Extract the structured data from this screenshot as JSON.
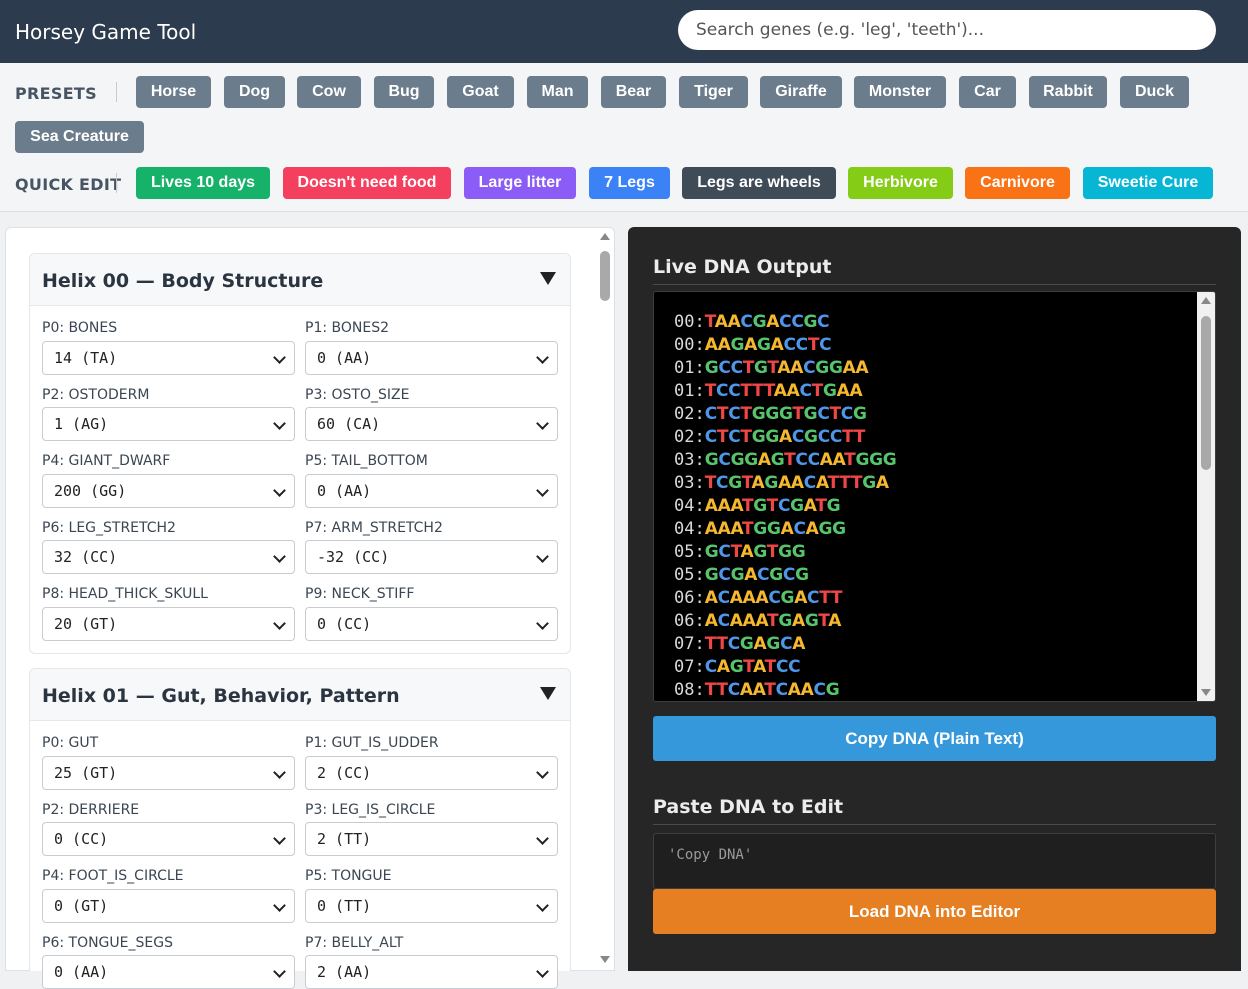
{
  "app": {
    "title": "Horsey Game Tool"
  },
  "search": {
    "placeholder": "Search genes (e.g. 'leg', 'teeth')..."
  },
  "presets": {
    "label": "PRESETS",
    "items": [
      "Horse",
      "Dog",
      "Cow",
      "Bug",
      "Goat",
      "Man",
      "Bear",
      "Tiger",
      "Giraffe",
      "Monster",
      "Car",
      "Rabbit",
      "Duck",
      "Sea Creature"
    ]
  },
  "quick_edit": {
    "label": "QUICK EDIT",
    "items": [
      {
        "label": "Lives 10 days",
        "color": "#17b26a"
      },
      {
        "label": "Doesn't need food",
        "color": "#f43f5e"
      },
      {
        "label": "Large litter",
        "color": "#8b5cf6"
      },
      {
        "label": "7 Legs",
        "color": "#3b82f6"
      },
      {
        "label": "Legs are wheels",
        "color": "#404b58"
      },
      {
        "label": "Herbivore",
        "color": "#84cc16"
      },
      {
        "label": "Carnivore",
        "color": "#f97316"
      },
      {
        "label": "Sweetie Cure",
        "color": "#06b6d4"
      }
    ]
  },
  "helices": [
    {
      "title": "Helix 00 — Body Structure",
      "fields": [
        {
          "label": "P0: BONES",
          "value": "14 (TA)"
        },
        {
          "label": "P1: BONES2",
          "value": "0 (AA)"
        },
        {
          "label": "P2: OSTODERM",
          "value": "1 (AG)"
        },
        {
          "label": "P3: OSTO_SIZE",
          "value": "60 (CA)"
        },
        {
          "label": "P4: GIANT_DWARF",
          "value": "200 (GG)"
        },
        {
          "label": "P5: TAIL_BOTTOM",
          "value": "0 (AA)"
        },
        {
          "label": "P6: LEG_STRETCH2",
          "value": "32 (CC)"
        },
        {
          "label": "P7: ARM_STRETCH2",
          "value": "-32 (CC)"
        },
        {
          "label": "P8: HEAD_THICK_SKULL",
          "value": "20 (GT)"
        },
        {
          "label": "P9: NECK_STIFF",
          "value": "0 (CC)"
        }
      ]
    },
    {
      "title": "Helix 01 — Gut, Behavior, Pattern",
      "fields": [
        {
          "label": "P0: GUT",
          "value": "25 (GT)"
        },
        {
          "label": "P1: GUT_IS_UDDER",
          "value": "2 (CC)"
        },
        {
          "label": "P2: DERRIERE",
          "value": "0 (CC)"
        },
        {
          "label": "P3: LEG_IS_CIRCLE",
          "value": "2 (TT)"
        },
        {
          "label": "P4: FOOT_IS_CIRCLE",
          "value": "0 (GT)"
        },
        {
          "label": "P5: TONGUE",
          "value": "0 (TT)"
        },
        {
          "label": "P6: TONGUE_SEGS",
          "value": "0 (AA)"
        },
        {
          "label": "P7: BELLY_ALT",
          "value": "2 (AA)"
        }
      ]
    }
  ],
  "output": {
    "title": "Live DNA Output",
    "base_colors": {
      "A": "#f5b82e",
      "C": "#4f95e8",
      "G": "#57c46b",
      "T": "#f04646"
    },
    "lines": [
      {
        "num": "00",
        "seq": "TAACGACCGC"
      },
      {
        "num": "00",
        "seq": "AAGAGACCTC"
      },
      {
        "num": "01",
        "seq": "GCCTGTAACGGAA"
      },
      {
        "num": "01",
        "seq": "TCCTTTAACTGAA"
      },
      {
        "num": "02",
        "seq": "CTCTGGGTGCTCG"
      },
      {
        "num": "02",
        "seq": "CTCTGGACGCCTT"
      },
      {
        "num": "03",
        "seq": "GCGGAGTCCAATGGG"
      },
      {
        "num": "03",
        "seq": "TCGTAGAACATTTGA"
      },
      {
        "num": "04",
        "seq": "AAATGTCGATG"
      },
      {
        "num": "04",
        "seq": "AAATGGACAGG"
      },
      {
        "num": "05",
        "seq": "GCTAGTGG"
      },
      {
        "num": "05",
        "seq": "GCGACGCG"
      },
      {
        "num": "06",
        "seq": "ACAAACGACTT"
      },
      {
        "num": "06",
        "seq": "ACAAATGAGTA"
      },
      {
        "num": "07",
        "seq": "TTCGAGCA"
      },
      {
        "num": "07",
        "seq": "CAGTATCC"
      },
      {
        "num": "08",
        "seq": "TTCAATCAACG"
      }
    ],
    "copy_label": "Copy DNA (Plain Text)",
    "copy_color": "#3498db"
  },
  "paste": {
    "title": "Paste DNA to Edit",
    "placeholder": "'Copy DNA'",
    "load_label": "Load DNA into Editor",
    "load_color": "#e67e22"
  }
}
